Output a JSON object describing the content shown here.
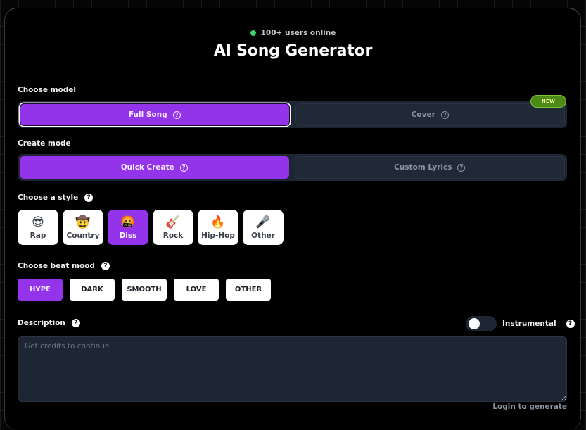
{
  "header": {
    "online_status": "100+ users online",
    "title": "AI Song Generator"
  },
  "model": {
    "label": "Choose model",
    "options": [
      {
        "label": "Full Song",
        "selected": true
      },
      {
        "label": "Cover",
        "selected": false
      }
    ],
    "badge": "NEW"
  },
  "mode": {
    "label": "Create mode",
    "options": [
      {
        "label": "Quick Create",
        "selected": true
      },
      {
        "label": "Custom Lyrics",
        "selected": false
      }
    ]
  },
  "style": {
    "label": "Choose a style",
    "help": "?",
    "options": [
      {
        "label": "Rap",
        "emoji": "😎",
        "selected": false
      },
      {
        "label": "Country",
        "emoji": "🤠",
        "selected": false
      },
      {
        "label": "Diss",
        "emoji": "🤬",
        "selected": true
      },
      {
        "label": "Rock",
        "emoji": "🎸",
        "selected": false
      },
      {
        "label": "Hip-Hop",
        "emoji": "🔥",
        "selected": false
      },
      {
        "label": "Other",
        "emoji": "🎤",
        "selected": false
      }
    ]
  },
  "mood": {
    "label": "Choose beat mood",
    "help": "?",
    "options": [
      {
        "label": "HYPE",
        "selected": true
      },
      {
        "label": "DARK",
        "selected": false
      },
      {
        "label": "SMOOTH",
        "selected": false
      },
      {
        "label": "LOVE",
        "selected": false
      },
      {
        "label": "OTHER",
        "selected": false
      }
    ]
  },
  "description": {
    "label": "Description",
    "help": "?",
    "placeholder": "Get credits to continue",
    "value": ""
  },
  "instrumental": {
    "label": "Instrumental",
    "help": "?",
    "enabled": false
  },
  "footer": {
    "login_link": "Login to generate"
  },
  "colors": {
    "accent": "#9333ea",
    "online_dot": "#3bd16f",
    "panel": "#1e2633",
    "badge": "#4d8a1a"
  }
}
